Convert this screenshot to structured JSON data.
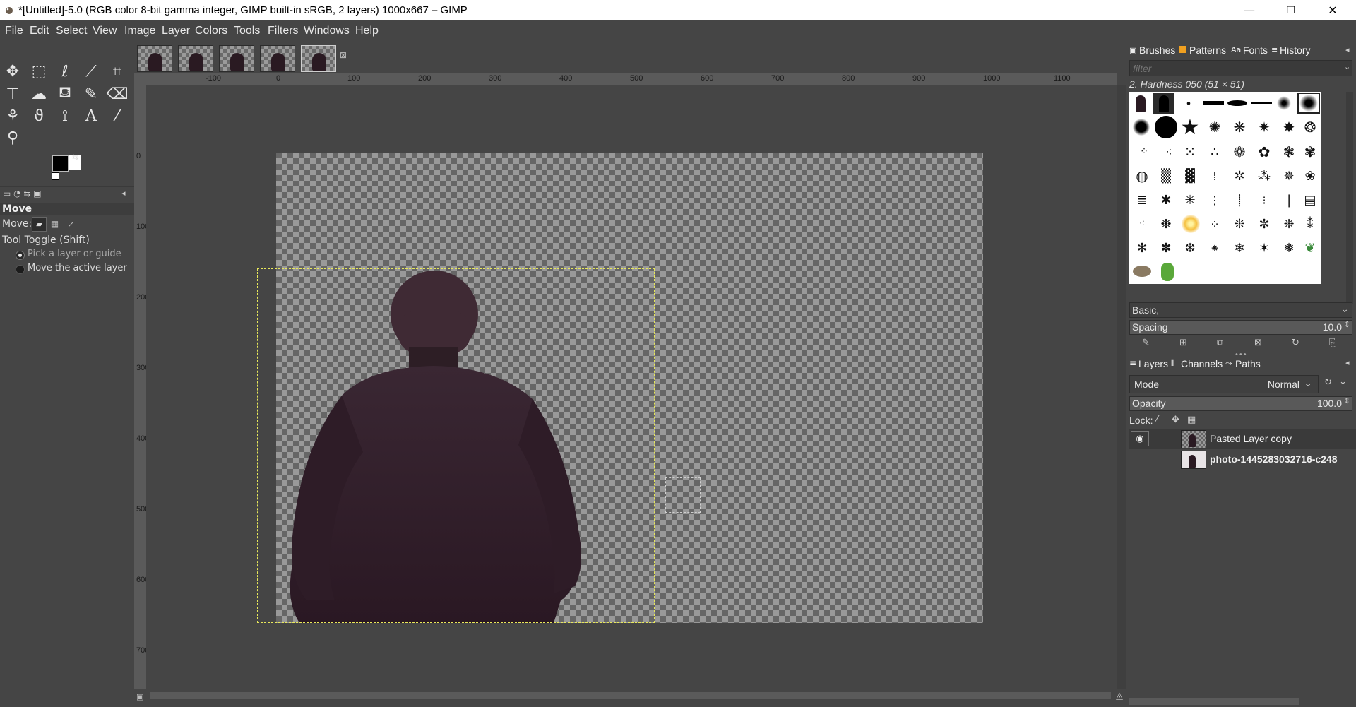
{
  "window": {
    "title": "*[Untitled]-5.0 (RGB color 8-bit gamma integer, GIMP built-in sRGB, 2 layers) 1000x667 – GIMP",
    "minimize": "—",
    "restore": "❐",
    "close": "✕"
  },
  "menubar": [
    "File",
    "Edit",
    "Select",
    "View",
    "Image",
    "Layer",
    "Colors",
    "Tools",
    "Filters",
    "Windows",
    "Help"
  ],
  "toolbox": {
    "tool_options_title": "Move",
    "move_label": "Move:",
    "tool_toggle_label": "Tool Toggle  (Shift)",
    "option_pick": "Pick a layer or guide",
    "option_move_active": "Move the active layer"
  },
  "rulers": {
    "h_labels": [
      "-100",
      "0",
      "100",
      "200",
      "300",
      "400",
      "500",
      "600",
      "700",
      "800",
      "900",
      "1000",
      "1100"
    ],
    "v_labels": [
      "0",
      "100",
      "200",
      "300",
      "400",
      "500",
      "600",
      "700"
    ]
  },
  "dock": {
    "tabs_top": [
      "Brushes",
      "Patterns",
      "Fonts",
      "History"
    ],
    "filter_placeholder": "filter",
    "brush_name": "2. Hardness 050 (51 × 51)",
    "brush_set": "Basic,",
    "spacing_label": "Spacing",
    "spacing_value": "10.0",
    "tabs_bottom": [
      "Layers",
      "Channels",
      "Paths"
    ],
    "mode_label": "Mode",
    "mode_value": "Normal",
    "opacity_label": "Opacity",
    "opacity_value": "100.0",
    "lock_label": "Lock:",
    "layers": [
      {
        "name": "Pasted Layer copy",
        "visible": true,
        "active": true
      },
      {
        "name": "photo-1445283032716-c248",
        "visible": false,
        "active": false
      }
    ]
  },
  "colors": {
    "foreground": "#000000",
    "background": "#ffffff",
    "layer_boundary": "#e8e85a"
  }
}
